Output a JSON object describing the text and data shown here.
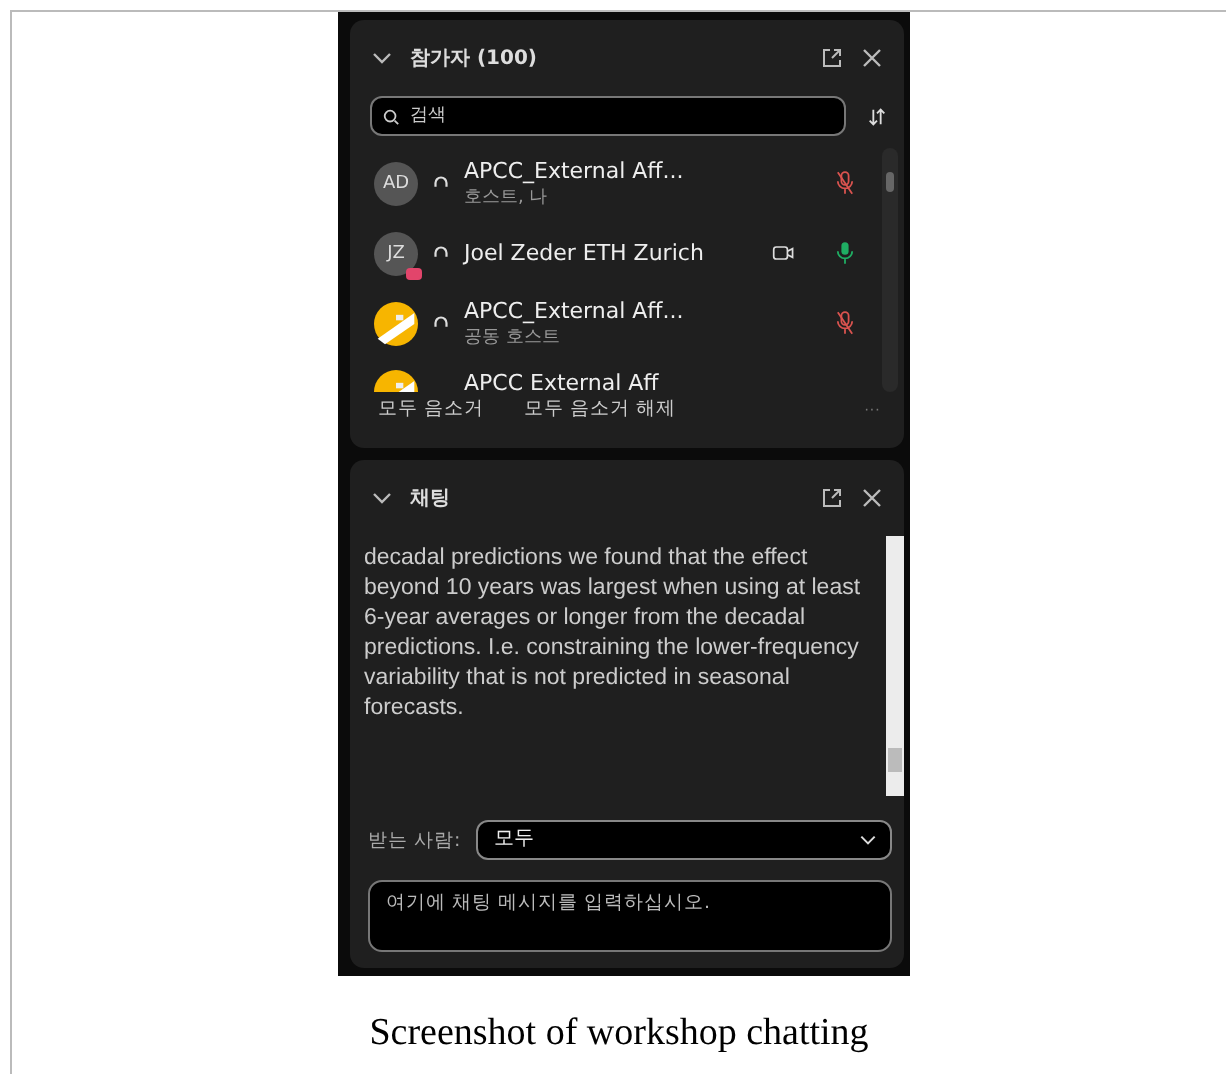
{
  "participants": {
    "title": "참가자 (100)",
    "search": {
      "placeholder": "검색"
    },
    "rows": [
      {
        "name": "APCC_External Aff...",
        "role": "호스트, 나",
        "avatar": {
          "kind": "initials",
          "text": "AD",
          "badge": false
        },
        "camera": false,
        "mic_muted": true
      },
      {
        "name": "Joel Zeder ETH Zurich",
        "avatar": {
          "kind": "initials",
          "text": "JZ",
          "badge": true
        },
        "camera": true,
        "mic_muted": false
      },
      {
        "name": "APCC_External Aff...",
        "role": "공동 호스트",
        "camera": false,
        "mic_muted": true
      },
      {
        "name": "APCC External Aff"
      }
    ],
    "actions": [
      "모두 음소거",
      "모두 음소거 해제"
    ],
    "more": "···"
  },
  "chat": {
    "title": "채팅",
    "message": "decadal predictions we found that the effect beyond 10 years was largest when using at least 6-year averages or longer from the decadal predictions. I.e. constraining the lower-frequency variability that is not predicted in seasonal forecasts.",
    "recipient_label": "받는 사람:",
    "recipient": "모두",
    "input": {
      "placeholder": "여기에 채팅 메시지를 입력하십시오."
    }
  },
  "caption": "Screenshot of workshop chatting"
}
